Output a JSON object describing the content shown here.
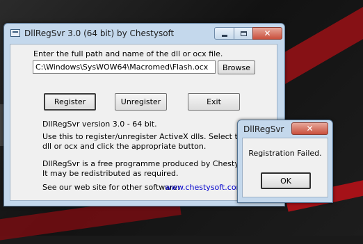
{
  "main_window": {
    "title": "DllRegSvr 3.0 (64 bit) by Chestysoft",
    "prompt": "Enter the full path and name of the dll or ocx file.",
    "path_value": "C:\\Windows\\SysWOW64\\Macromed\\Flash.ocx",
    "buttons": {
      "browse": "Browse",
      "register": "Register",
      "unregister": "Unregister",
      "exit": "Exit"
    },
    "info_lines": [
      "DllRegSvr version 3.0 - 64 bit.",
      "Use this to register/unregister ActiveX dlls. Select the",
      "dll or ocx and click the appropriate button.",
      "DllRegSvr is a free programme produced by Chestysoft.",
      "It may be redistributed as required."
    ],
    "website_label": "See our web site for other software:",
    "website_link": "www.chestysoft.com",
    "caption_icons": [
      "minimize-icon",
      "maximize-icon",
      "close-icon"
    ]
  },
  "message_box": {
    "title": "DllRegSvr",
    "message": "Registration Failed.",
    "ok_label": "OK",
    "close_glyph": "✕"
  },
  "colors": {
    "titlebar": "#c4d8ec",
    "client": "#f0f0f0",
    "close_button": "#c9503d",
    "link": "#0000cc",
    "desktop_accent": "#b51218"
  }
}
